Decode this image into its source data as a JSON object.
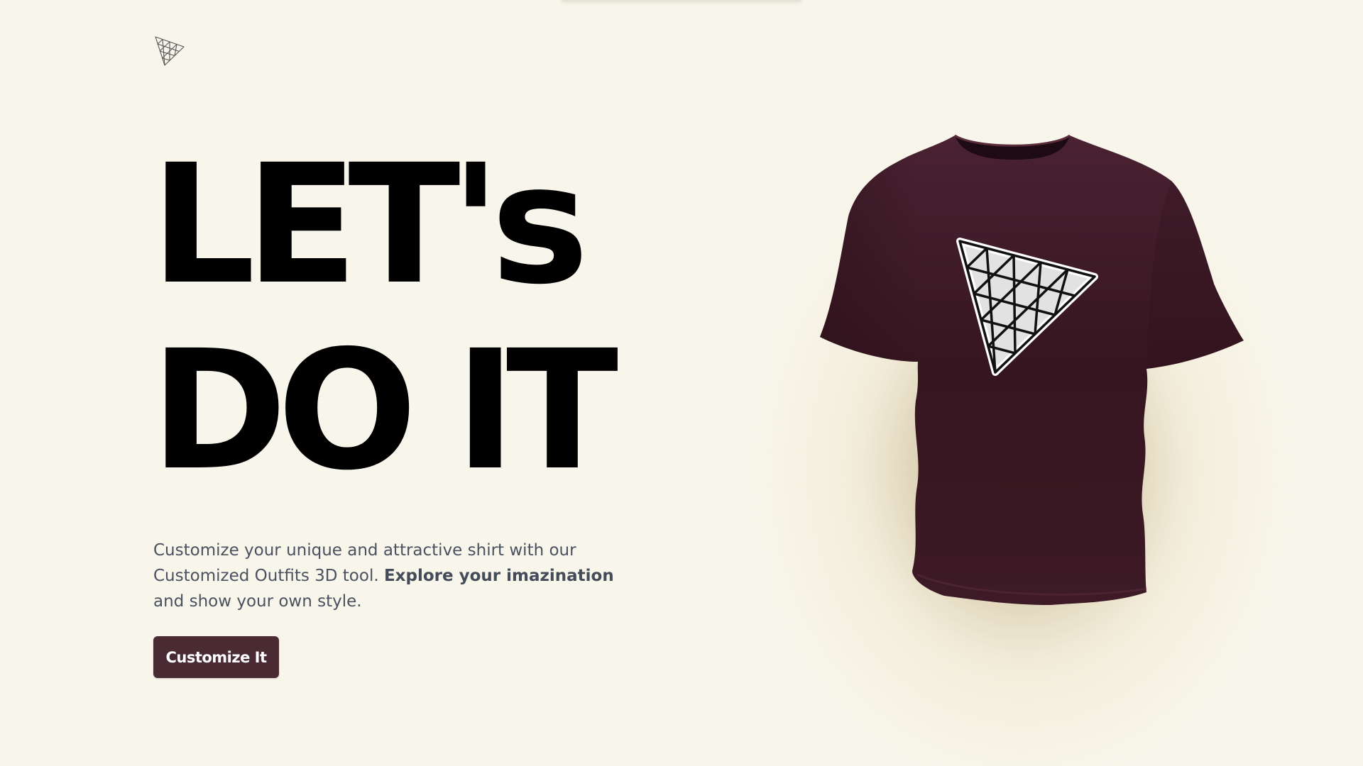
{
  "hero": {
    "headline_line1": "LET's",
    "headline_line2": "DO IT",
    "description_part1": "Customize your unique and attractive shirt with our Customized Outfits 3D tool. ",
    "description_bold": "Explore your imazination",
    "description_part2": " and show your own style.",
    "cta_label": "Customize It"
  },
  "colors": {
    "background": "#f8f5ea",
    "accent": "#4a2a33",
    "shirt": "#3a1a24",
    "headline": "#000000",
    "body_text": "#4a5160"
  },
  "icons": {
    "logo": "triangle-mesh-logo-icon",
    "shirt_print": "triangle-mesh-logo-icon"
  }
}
